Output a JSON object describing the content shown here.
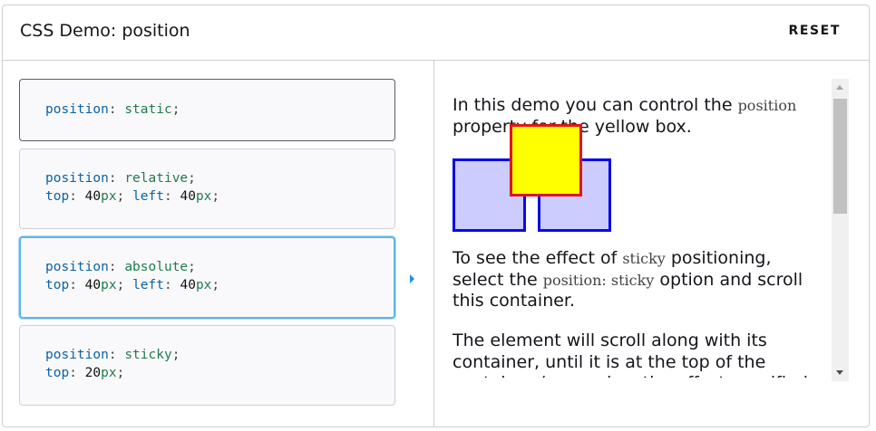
{
  "header": {
    "title": "CSS Demo: position",
    "reset_label": "RESET"
  },
  "choices": [
    {
      "line1": {
        "prop": "position",
        "colon": ": ",
        "value": "static",
        "semi": ";"
      }
    },
    {
      "line1": {
        "prop": "position",
        "colon": ": ",
        "value": "relative",
        "semi": ";"
      },
      "line2": {
        "prop1": "top",
        "c1": ": ",
        "n1": "40",
        "u1": "px",
        "s1": "; ",
        "prop2": "left",
        "c2": ": ",
        "n2": "40",
        "u2": "px",
        "s2": ";"
      }
    },
    {
      "line1": {
        "prop": "position",
        "colon": ": ",
        "value": "absolute",
        "semi": ";"
      },
      "line2": {
        "prop1": "top",
        "c1": ": ",
        "n1": "40",
        "u1": "px",
        "s1": "; ",
        "prop2": "left",
        "c2": ": ",
        "n2": "40",
        "u2": "px",
        "s2": ";"
      }
    },
    {
      "line1": {
        "prop": "position",
        "colon": ": ",
        "value": "sticky",
        "semi": ";"
      },
      "line2": {
        "prop1": "top",
        "c1": ": ",
        "n1": "20",
        "u1": "px",
        "s1": ";"
      }
    }
  ],
  "output": {
    "p1": {
      "t1": "In this demo you can control the ",
      "code": "position",
      "t2": " property for the yellow box."
    },
    "p2": {
      "t1": "To see the effect of ",
      "code1": "sticky",
      "t2": " positioning, select the ",
      "code2": "position: sticky",
      "t3": " option and scroll this container."
    },
    "p3": {
      "t1": "The element will scroll along with its container, until it is at the top of the container (or reaches the offset specified in"
    }
  },
  "colors": {
    "selected_border": "#5fb4ec",
    "box_fill": "#ccccff",
    "box_border": "#0a0ae6",
    "yellow": "#ffff00",
    "yellow_border": "#e0141e"
  }
}
